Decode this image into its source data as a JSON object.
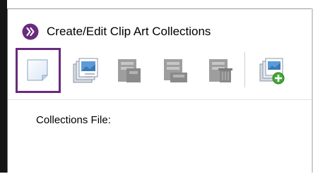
{
  "window": {
    "title": "Create/Edit Clip Art Collections",
    "app_icon": "chevron-right-app-icon",
    "accent_color": "#6a2a7d"
  },
  "toolbar": {
    "buttons": [
      {
        "icon": "new-document-icon",
        "state": "selected"
      },
      {
        "icon": "open-collection-icon",
        "state": "enabled"
      },
      {
        "icon": "save-collection-icon",
        "state": "disabled"
      },
      {
        "icon": "save-as-collection-icon",
        "state": "disabled"
      },
      {
        "icon": "delete-collection-icon",
        "state": "disabled"
      },
      {
        "icon": "add-clip-art-icon",
        "state": "enabled"
      }
    ]
  },
  "content": {
    "collections_file_label": "Collections File:"
  }
}
